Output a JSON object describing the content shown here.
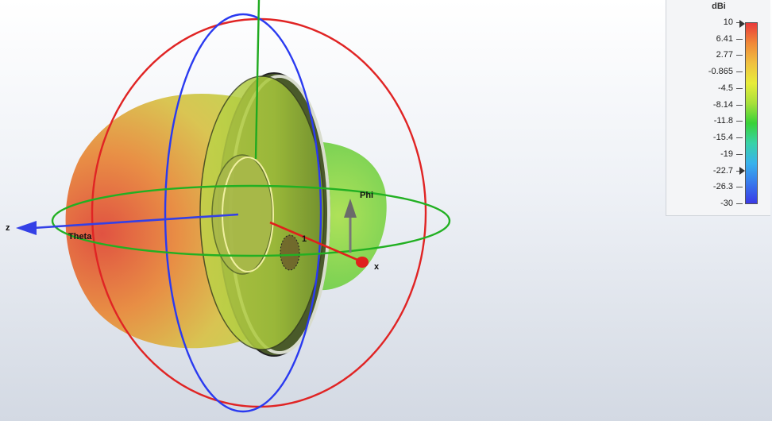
{
  "viewport": {
    "axes": {
      "x_label": "x",
      "z_label": "z",
      "phi_label": "Phi",
      "theta_label": "Theta",
      "port_label": "1"
    },
    "colors": {
      "x_axis": "#e0201c",
      "y_axis": "#1faa1f",
      "z_axis": "#3340e6",
      "phi_ring": "#22b022",
      "theta_ring": "#e02424",
      "cut_ring": "#2a3af0"
    }
  },
  "legend": {
    "unit": "dBi",
    "ticks": [
      "10",
      "6.41",
      "2.77",
      "-0.865",
      "-4.5",
      "-8.14",
      "-11.8",
      "-15.4",
      "-19",
      "-22.7",
      "-26.3",
      "-30"
    ],
    "max_marker_value": "10",
    "min_marker_value": "-22.7",
    "colors": [
      "#e83a3a",
      "#f08838",
      "#f0c040",
      "#e8ec3a",
      "#a8e03a",
      "#38d238",
      "#38d2a8",
      "#38b2ec",
      "#3878ec",
      "#3a3ae6"
    ]
  }
}
